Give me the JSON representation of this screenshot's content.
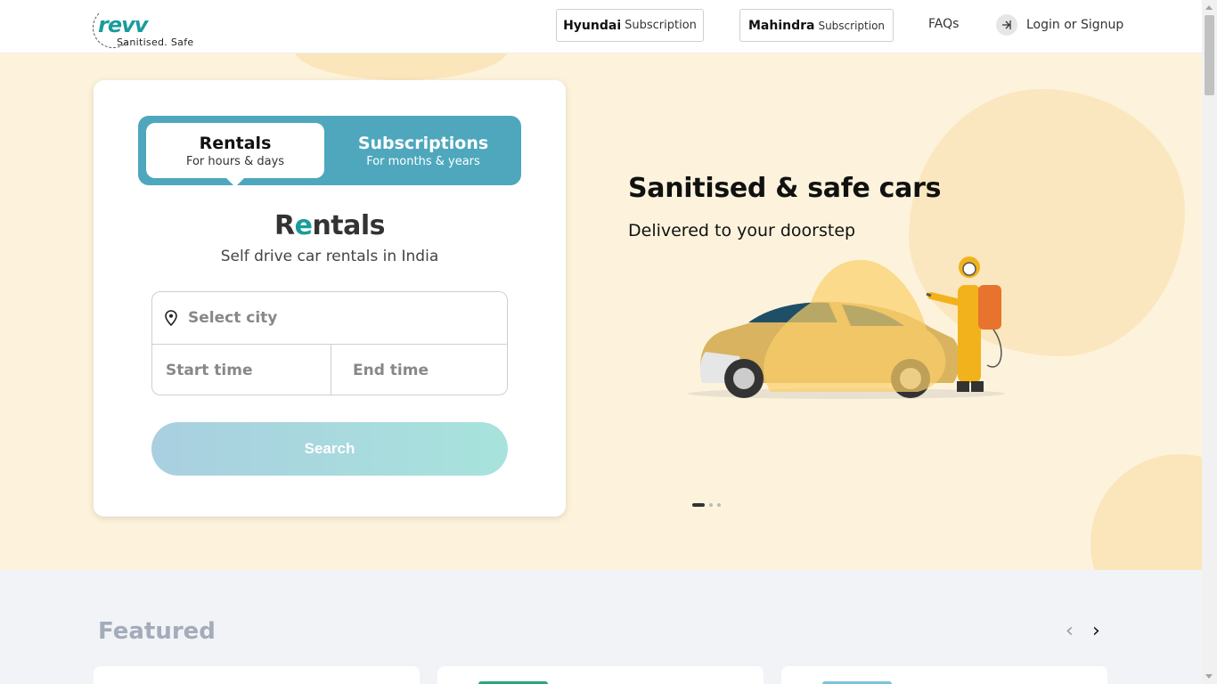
{
  "header": {
    "logo_text": "revv",
    "logo_tagline": "Sanitised. Safe",
    "hyundai_brand": "Hyundai",
    "hyundai_sub": "Subscription",
    "mahindra_brand": "Mahindra",
    "mahindra_sub": "Subscription",
    "faqs": "FAQs",
    "login": "Login or Signup"
  },
  "booking": {
    "tabs": [
      {
        "title": "Rentals",
        "subtitle": "For hours & days",
        "active": true
      },
      {
        "title": "Subscriptions",
        "subtitle": "For months & years",
        "active": false
      }
    ],
    "brand_prefix": "R",
    "brand_accent": "e",
    "brand_suffix": "ntals",
    "brand_subtitle": "Self drive car rentals in India",
    "city_placeholder": "Select city",
    "start_placeholder": "Start time",
    "end_placeholder": "End time",
    "search_label": "Search"
  },
  "hero": {
    "title": "Sanitised & safe cars",
    "subtitle": "Delivered to your doorstep",
    "carousel_slides": 3,
    "active_slide": 1
  },
  "featured": {
    "title": "Featured",
    "card_accent_colors": [
      "#ffffff",
      "#2aa67e",
      "#7cc3dd"
    ]
  },
  "colors": {
    "accent_teal": "#4ea7bd",
    "hero_bg": "#fdf3dc",
    "brand_teal": "#1a9c9c"
  }
}
